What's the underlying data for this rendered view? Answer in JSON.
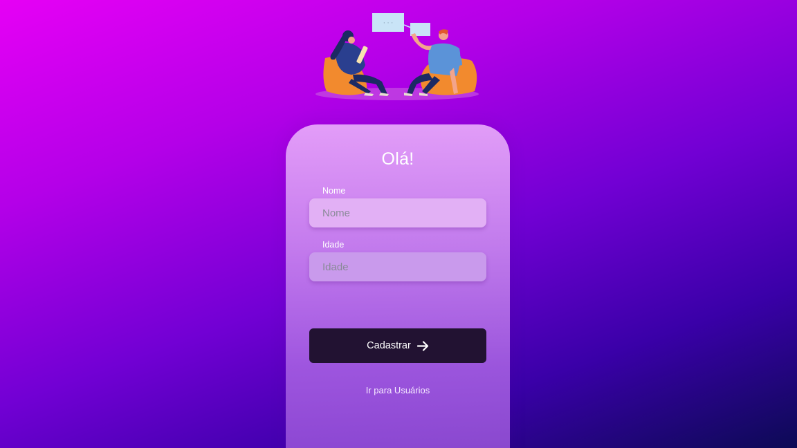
{
  "illustration": {
    "name": "people-conversation-illustration",
    "speech_bubble_text": "· · ·"
  },
  "form": {
    "title": "Olá!",
    "fields": [
      {
        "label": "Nome",
        "placeholder": "Nome",
        "value": ""
      },
      {
        "label": "Idade",
        "placeholder": "Idade",
        "value": ""
      }
    ],
    "submit_label": "Cadastrar",
    "submit_icon": "arrow-right-icon",
    "users_link_label": "Ir para Usuários"
  },
  "colors": {
    "background_start": "#e600f5",
    "background_end": "#0c0a55",
    "button_background": "#221232",
    "card_tint": "#d99cf3"
  }
}
